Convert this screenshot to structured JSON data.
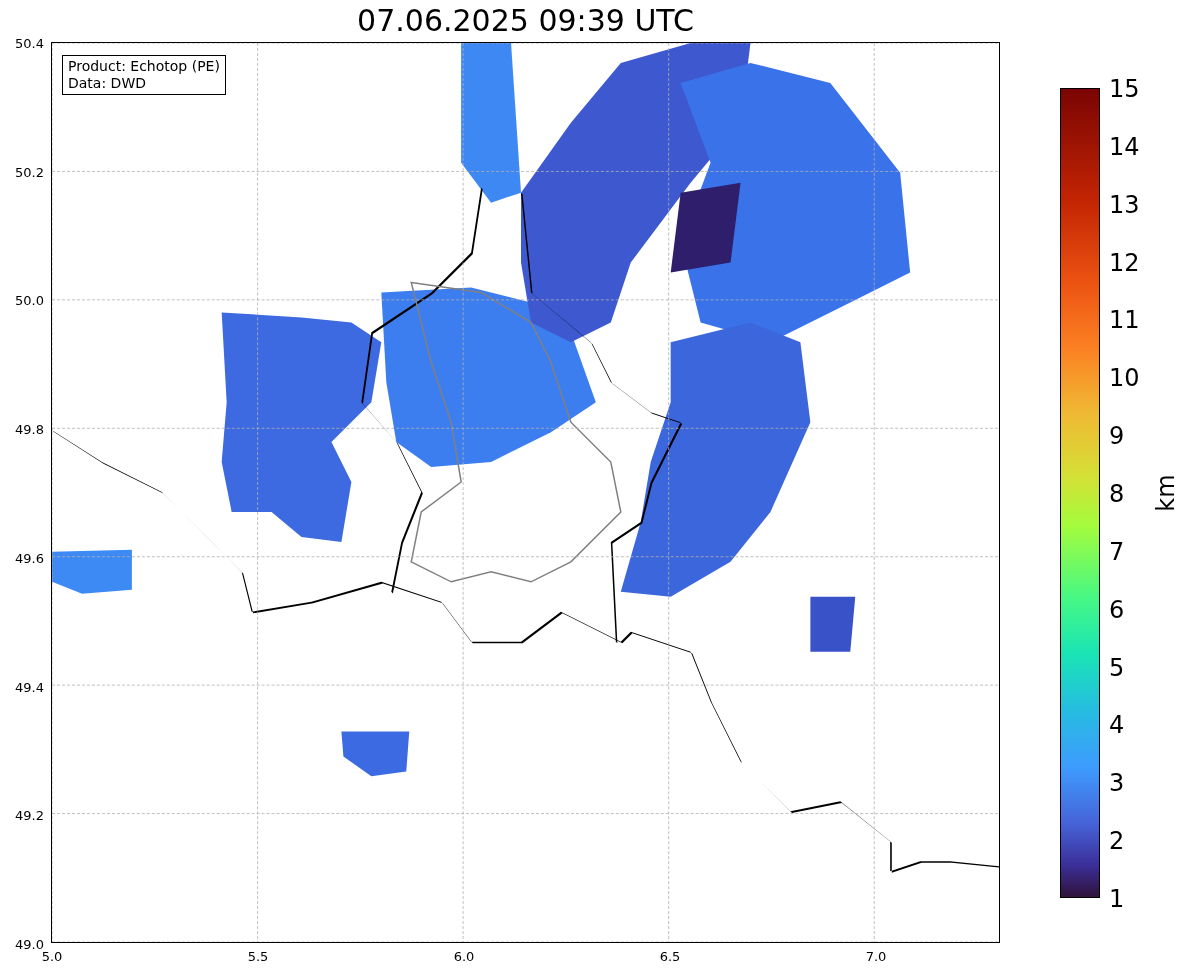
{
  "title": "07.06.2025 09:39 UTC",
  "legend": {
    "lines": [
      "Product: Echotop (PE)",
      "Data: DWD"
    ]
  },
  "x_axis": {
    "ticks": [
      "5.0",
      "5.5",
      "6.0",
      "6.5",
      "7.0"
    ]
  },
  "y_axis": {
    "ticks": [
      "50.4",
      "50.2",
      "50.0",
      "49.8",
      "49.6",
      "49.4",
      "49.2",
      "49.0"
    ]
  },
  "colorbar": {
    "label": "km",
    "ticks": [
      "15",
      "14",
      "13",
      "12",
      "11",
      "10",
      "9",
      "8",
      "7",
      "6",
      "5",
      "4",
      "3",
      "2",
      "1"
    ]
  }
}
